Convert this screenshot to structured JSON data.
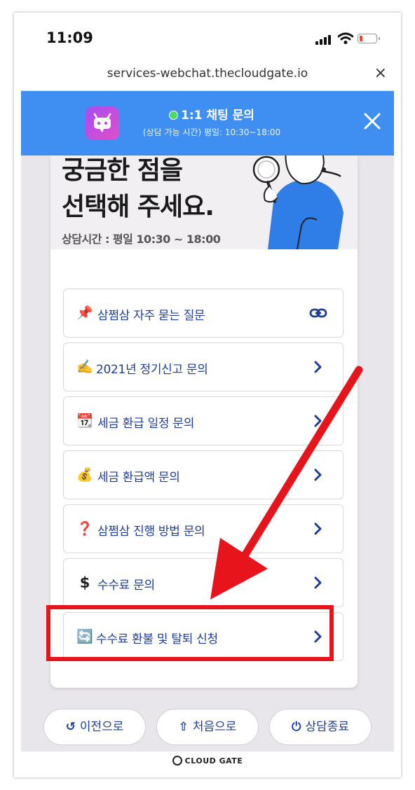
{
  "status_bar": {
    "time": "11:09"
  },
  "browser": {
    "url": "services-webchat.thecloudgate.io",
    "close_glyph": "×"
  },
  "chat_header": {
    "title": "1:1 채팅 문의",
    "subtitle": "(상담 가능 시간) 평일: 10:30~18:00",
    "accent_color": "#3f8ef2",
    "online_color": "#4cd964"
  },
  "banner": {
    "line1": "궁금한 점을",
    "line2": "선택해 주세요.",
    "hours": "상담시간 : 평일 10:30 ~ 18:00"
  },
  "menu": {
    "items": [
      {
        "icon": "📌",
        "icon_name": "pushpin-icon",
        "label": "삼쩜삼 자주 묻는 질문",
        "action": "link-icon"
      },
      {
        "icon": "✍️",
        "icon_name": "writing-hand-icon",
        "label": "2021년 정기신고 문의",
        "action": "chevron-right-icon"
      },
      {
        "icon": "📆",
        "icon_name": "calendar-icon",
        "label": "세금 환급 일정 문의",
        "action": "chevron-right-icon"
      },
      {
        "icon": "💰",
        "icon_name": "money-bag-icon",
        "label": "세금 환급액 문의",
        "action": "chevron-right-icon"
      },
      {
        "icon": "❓",
        "icon_name": "question-mark-icon",
        "label": "삼쩜삼 진행 방법 문의",
        "action": "chevron-right-icon"
      },
      {
        "icon": "$",
        "icon_name": "dollar-sign-icon",
        "label": "수수료 문의",
        "action": "chevron-right-icon"
      },
      {
        "icon": "🔄",
        "icon_name": "refresh-icon",
        "label": "수수료 환불 및 탈퇴 신청",
        "action": "chevron-right-icon"
      }
    ],
    "label_color": "#1d3e9c"
  },
  "annotation": {
    "highlight_color": "#e8141c"
  },
  "footer": {
    "prev": {
      "icon": "↺",
      "label": "이전으로"
    },
    "home": {
      "icon": "⇧",
      "label": "처음으로"
    },
    "end": {
      "icon": "⏻",
      "label": "상담종료"
    }
  },
  "brand": {
    "name": "CLOUD GATE"
  }
}
